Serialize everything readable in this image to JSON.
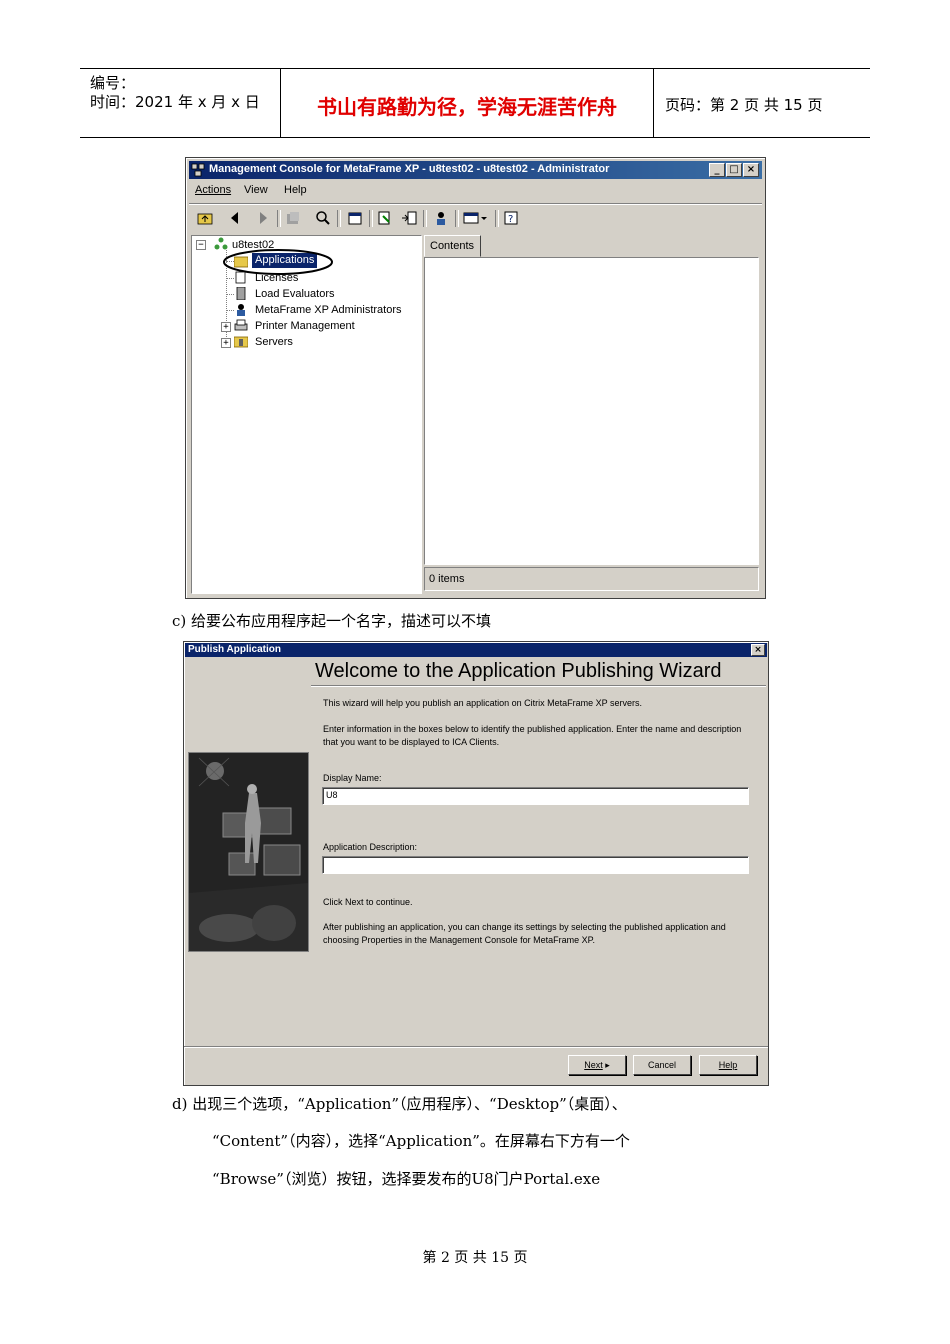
{
  "header": {
    "number_label": "编号：",
    "time_label": "时间：2021 年 x 月 x 日",
    "motto": "书山有路勤为径，学海无涯苦作舟",
    "page_info": "页码：第 2 页  共 15 页"
  },
  "mmc": {
    "title": "Management Console for MetaFrame XP - u8test02 - u8test02 - Administrator",
    "menu": [
      "Actions",
      "View",
      "Help"
    ],
    "tree": {
      "root": "u8test02",
      "items": [
        "Applications",
        "Licenses",
        "Load Evaluators",
        "MetaFrame XP Administrators",
        "Printer Management",
        "Servers"
      ]
    },
    "tab": "Contents",
    "status": "0 items"
  },
  "caption_c": "c)   给要公布应用程序起一个名字，描述可以不填",
  "dialog": {
    "title": "Publish Application",
    "heading": "Welcome to the Application Publishing Wizard",
    "intro": "This wizard will help you publish an application on Citrix MetaFrame XP servers.",
    "instructions": "Enter information in the boxes below to identify the published application.  Enter the name and description that you want to be displayed to ICA Clients.",
    "display_name_label": "Display Name:",
    "display_name_value": "U8",
    "description_label": "Application Description:",
    "description_value": "",
    "click_next": "Click Next to continue.",
    "after_text": "After publishing an application, you can change its settings by selecting the published application and choosing Properties in the Management Console for MetaFrame XP.",
    "buttons": {
      "next": "Next",
      "cancel": "Cancel",
      "help": "Help"
    }
  },
  "caption_d": {
    "line1": "d)   出现三个选项，“Application”（应用程序）、“Desktop”（桌面）、",
    "line2": "“Content”（内容），选择“Application”。在屏幕右下方有一个",
    "line3": "“Browse”（浏览）按钮，选择要发布的U8门户Portal.exe"
  },
  "footer": "第 2 页 共 15 页",
  "colors": {
    "motto": "#e00000",
    "titlebar": "#0a246a",
    "selection": "#0a246a",
    "face": "#d4d0c8"
  }
}
